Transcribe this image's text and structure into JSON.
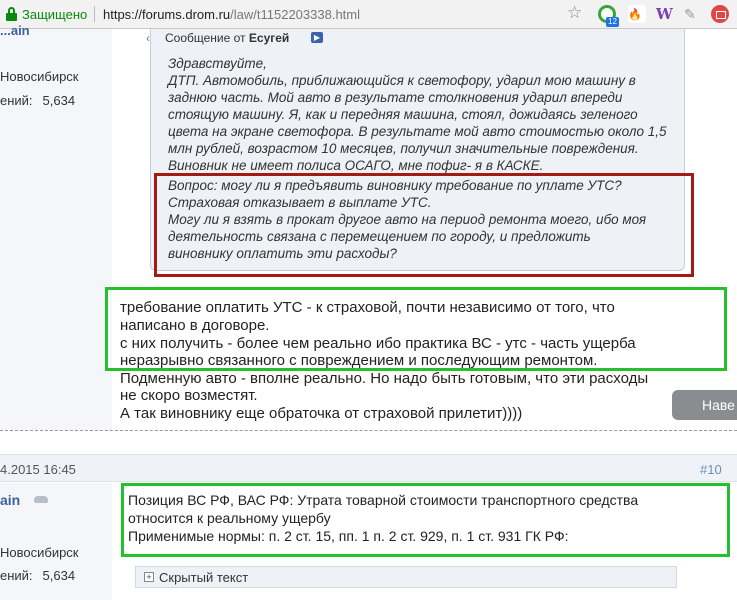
{
  "browser": {
    "secure_label": "Защищено",
    "url_scheme_host": "https://forums.drom.ru",
    "url_path": "/law/t1152203338.html",
    "ext_badge": "12",
    "ext_w": "W"
  },
  "post1": {
    "user_partial": "...ain",
    "city": "Новосибирск",
    "messages_label": "ений:",
    "messages_count": "5,634",
    "quote": {
      "prefix": "Сообщение от",
      "author": "Есугей",
      "lines": [
        "Здравствуйте,",
        "ДТП. Автомобиль, приближающийся к светофору, ударил мою машину в",
        "заднюю часть. Мой авто в результате столкновения ударил впереди",
        "стоящую машину. Я, как и передняя машина, стоял, дожидаясь зеленого",
        "цвета на экране светофора. В результате мой авто стоимостью около 1,5",
        "млн рублей, возрастом 10 месяцев, получил значительные повреждения.",
        "Виновник не имеет полиса ОСАГО, мне пофиг- я в КАСКЕ.",
        "Вопрос: могу ли я предъявить виновнику требование по уплате УТС?",
        "Страховая отказывает в выплате УТС.",
        "Могу ли я взять в прокат другое авто на период ремонта моего, ибо моя",
        "деятельность связана с перемещением по городу, и предложить",
        "виновнику оплатить эти расходы?"
      ]
    },
    "answer_box": [
      "требование оплатить УТС - к страховой, почти независимо от того, что",
      "написано в договоре.",
      "с них получить - более чем реально ибо практика ВС - утс - часть ущерба",
      "неразрывно связанного с повреждением и последующим ремонтом."
    ],
    "answer_rest": [
      "Подменную авто - вполне реально. Но надо быть готовым, что эти расходы",
      "не скоро возместят.",
      "А так виновнику еще обраточка от страховой прилетит))))"
    ],
    "next_button": "Наве"
  },
  "post2": {
    "date": "4.2015 16:45",
    "number": "#10",
    "user_partial": "ain",
    "city": "Новосибирск",
    "messages_label": "ений:",
    "messages_count": "5,634",
    "lines": [
      "Позиция ВС РФ, ВАС РФ: Утрата товарной стоимости транспортного средства",
      "относится к реальному ущербу",
      "Применимые нормы: п. 2 ст. 15, пп. 1 п. 2 ст. 929, п. 1 ст. 931 ГК РФ:"
    ],
    "spoiler_label": "Скрытый текст"
  },
  "colors": {
    "secure_green": "#0a8a0a",
    "highlight_red": "#a31b12",
    "highlight_green": "#25c02c",
    "link_blue": "#3a62a0"
  }
}
